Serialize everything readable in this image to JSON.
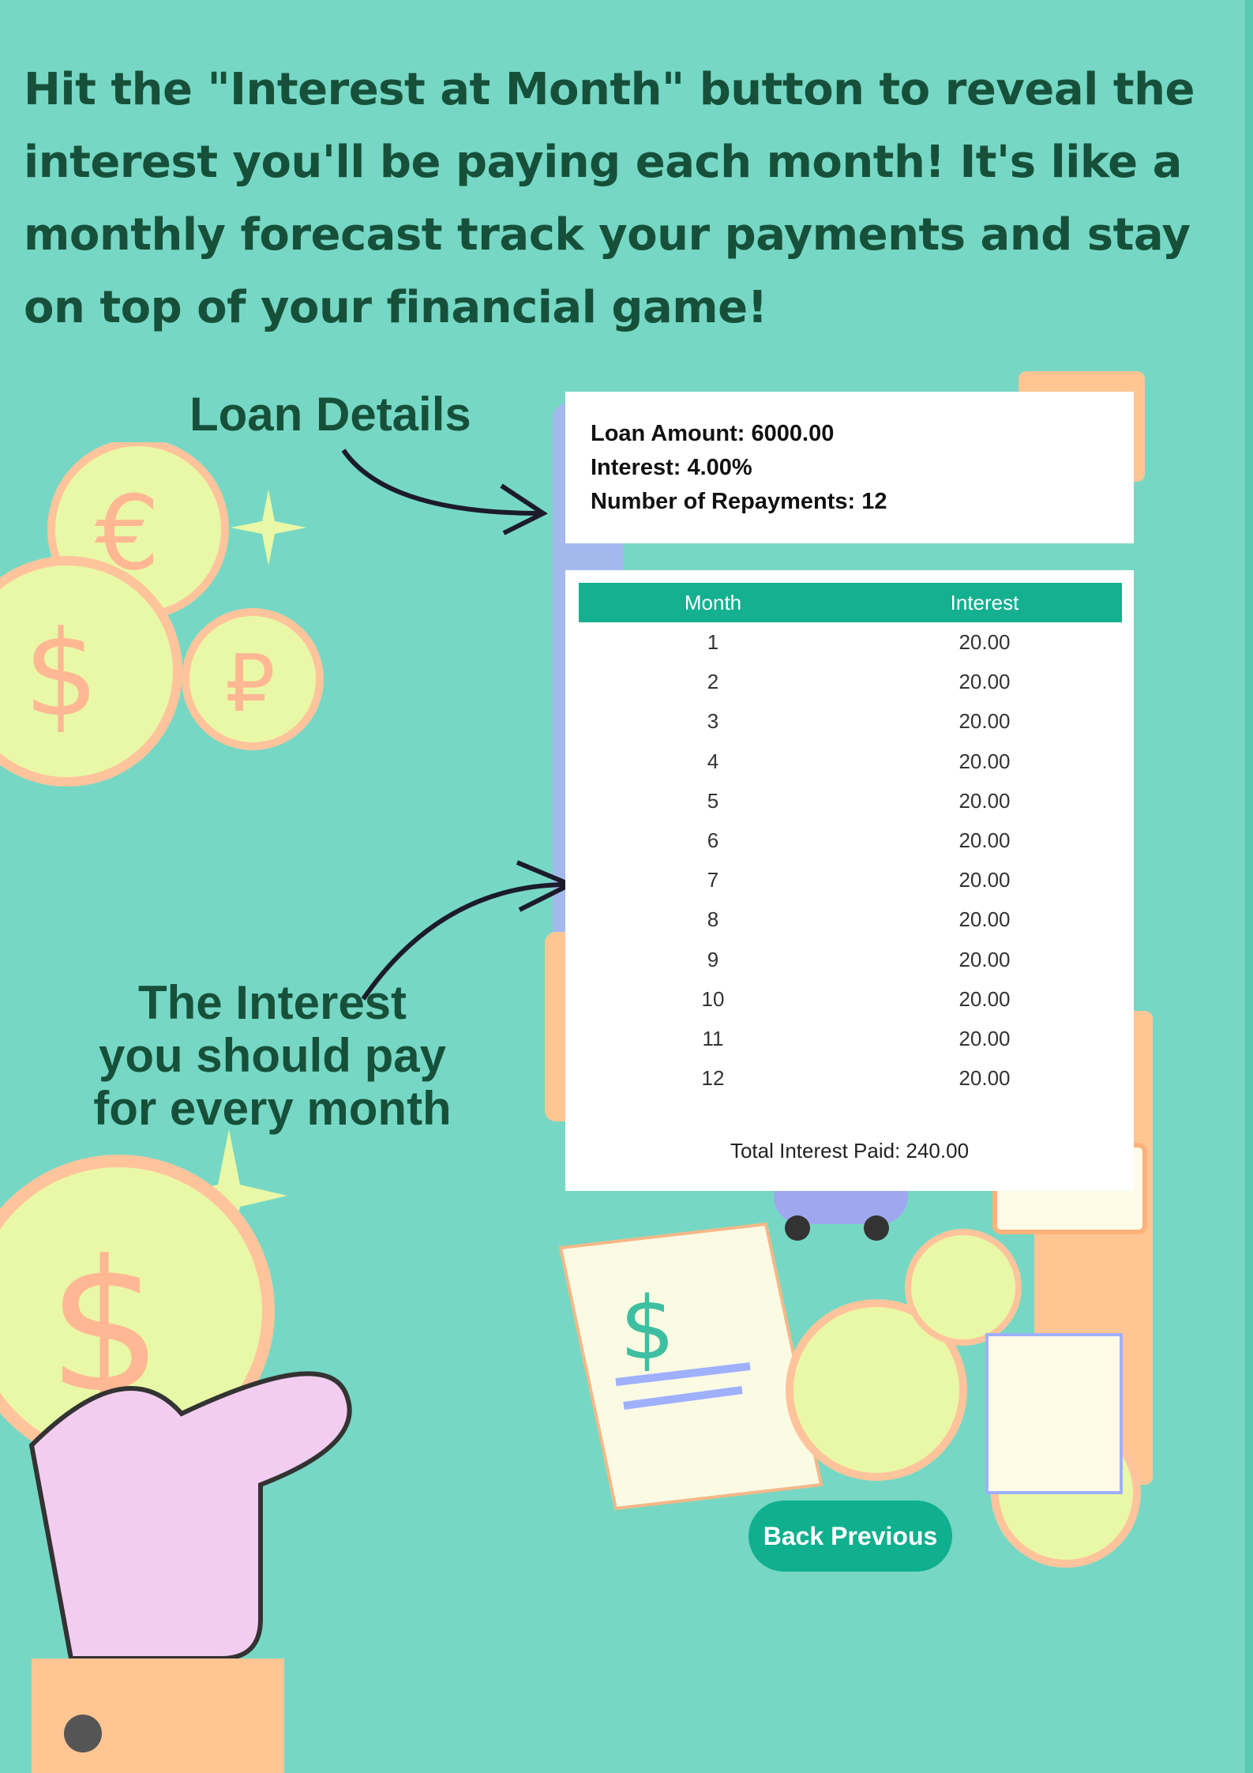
{
  "headline": {
    "line1": "Hit the \"Interest at Month\" button to reveal the",
    "line2": "interest you'll be paying each month! It's like a",
    "line3": "monthly forecast track your payments and stay",
    "line4": "on top of your financial game!"
  },
  "annotations": {
    "loan_details": "Loan Details",
    "interest_line1": "The Interest",
    "interest_line2": "you should pay",
    "interest_line3": "for every month"
  },
  "loan": {
    "amount": "Loan Amount: 6000.00",
    "interest": "Interest: 4.00%",
    "repayments": "Number of Repayments: 12"
  },
  "table": {
    "headers": [
      "Month",
      "Interest"
    ],
    "rows": [
      [
        "1",
        "20.00"
      ],
      [
        "2",
        "20.00"
      ],
      [
        "3",
        "20.00"
      ],
      [
        "4",
        "20.00"
      ],
      [
        "5",
        "20.00"
      ],
      [
        "6",
        "20.00"
      ],
      [
        "7",
        "20.00"
      ],
      [
        "8",
        "20.00"
      ],
      [
        "9",
        "20.00"
      ],
      [
        "10",
        "20.00"
      ],
      [
        "11",
        "20.00"
      ],
      [
        "12",
        "20.00"
      ]
    ],
    "total": "Total Interest Paid: 240.00"
  },
  "buttons": {
    "back": "Back Previous"
  },
  "colors": {
    "background": "#76d8c4",
    "headline": "#17503a",
    "accent": "#14b090",
    "button": "#10b08e"
  }
}
